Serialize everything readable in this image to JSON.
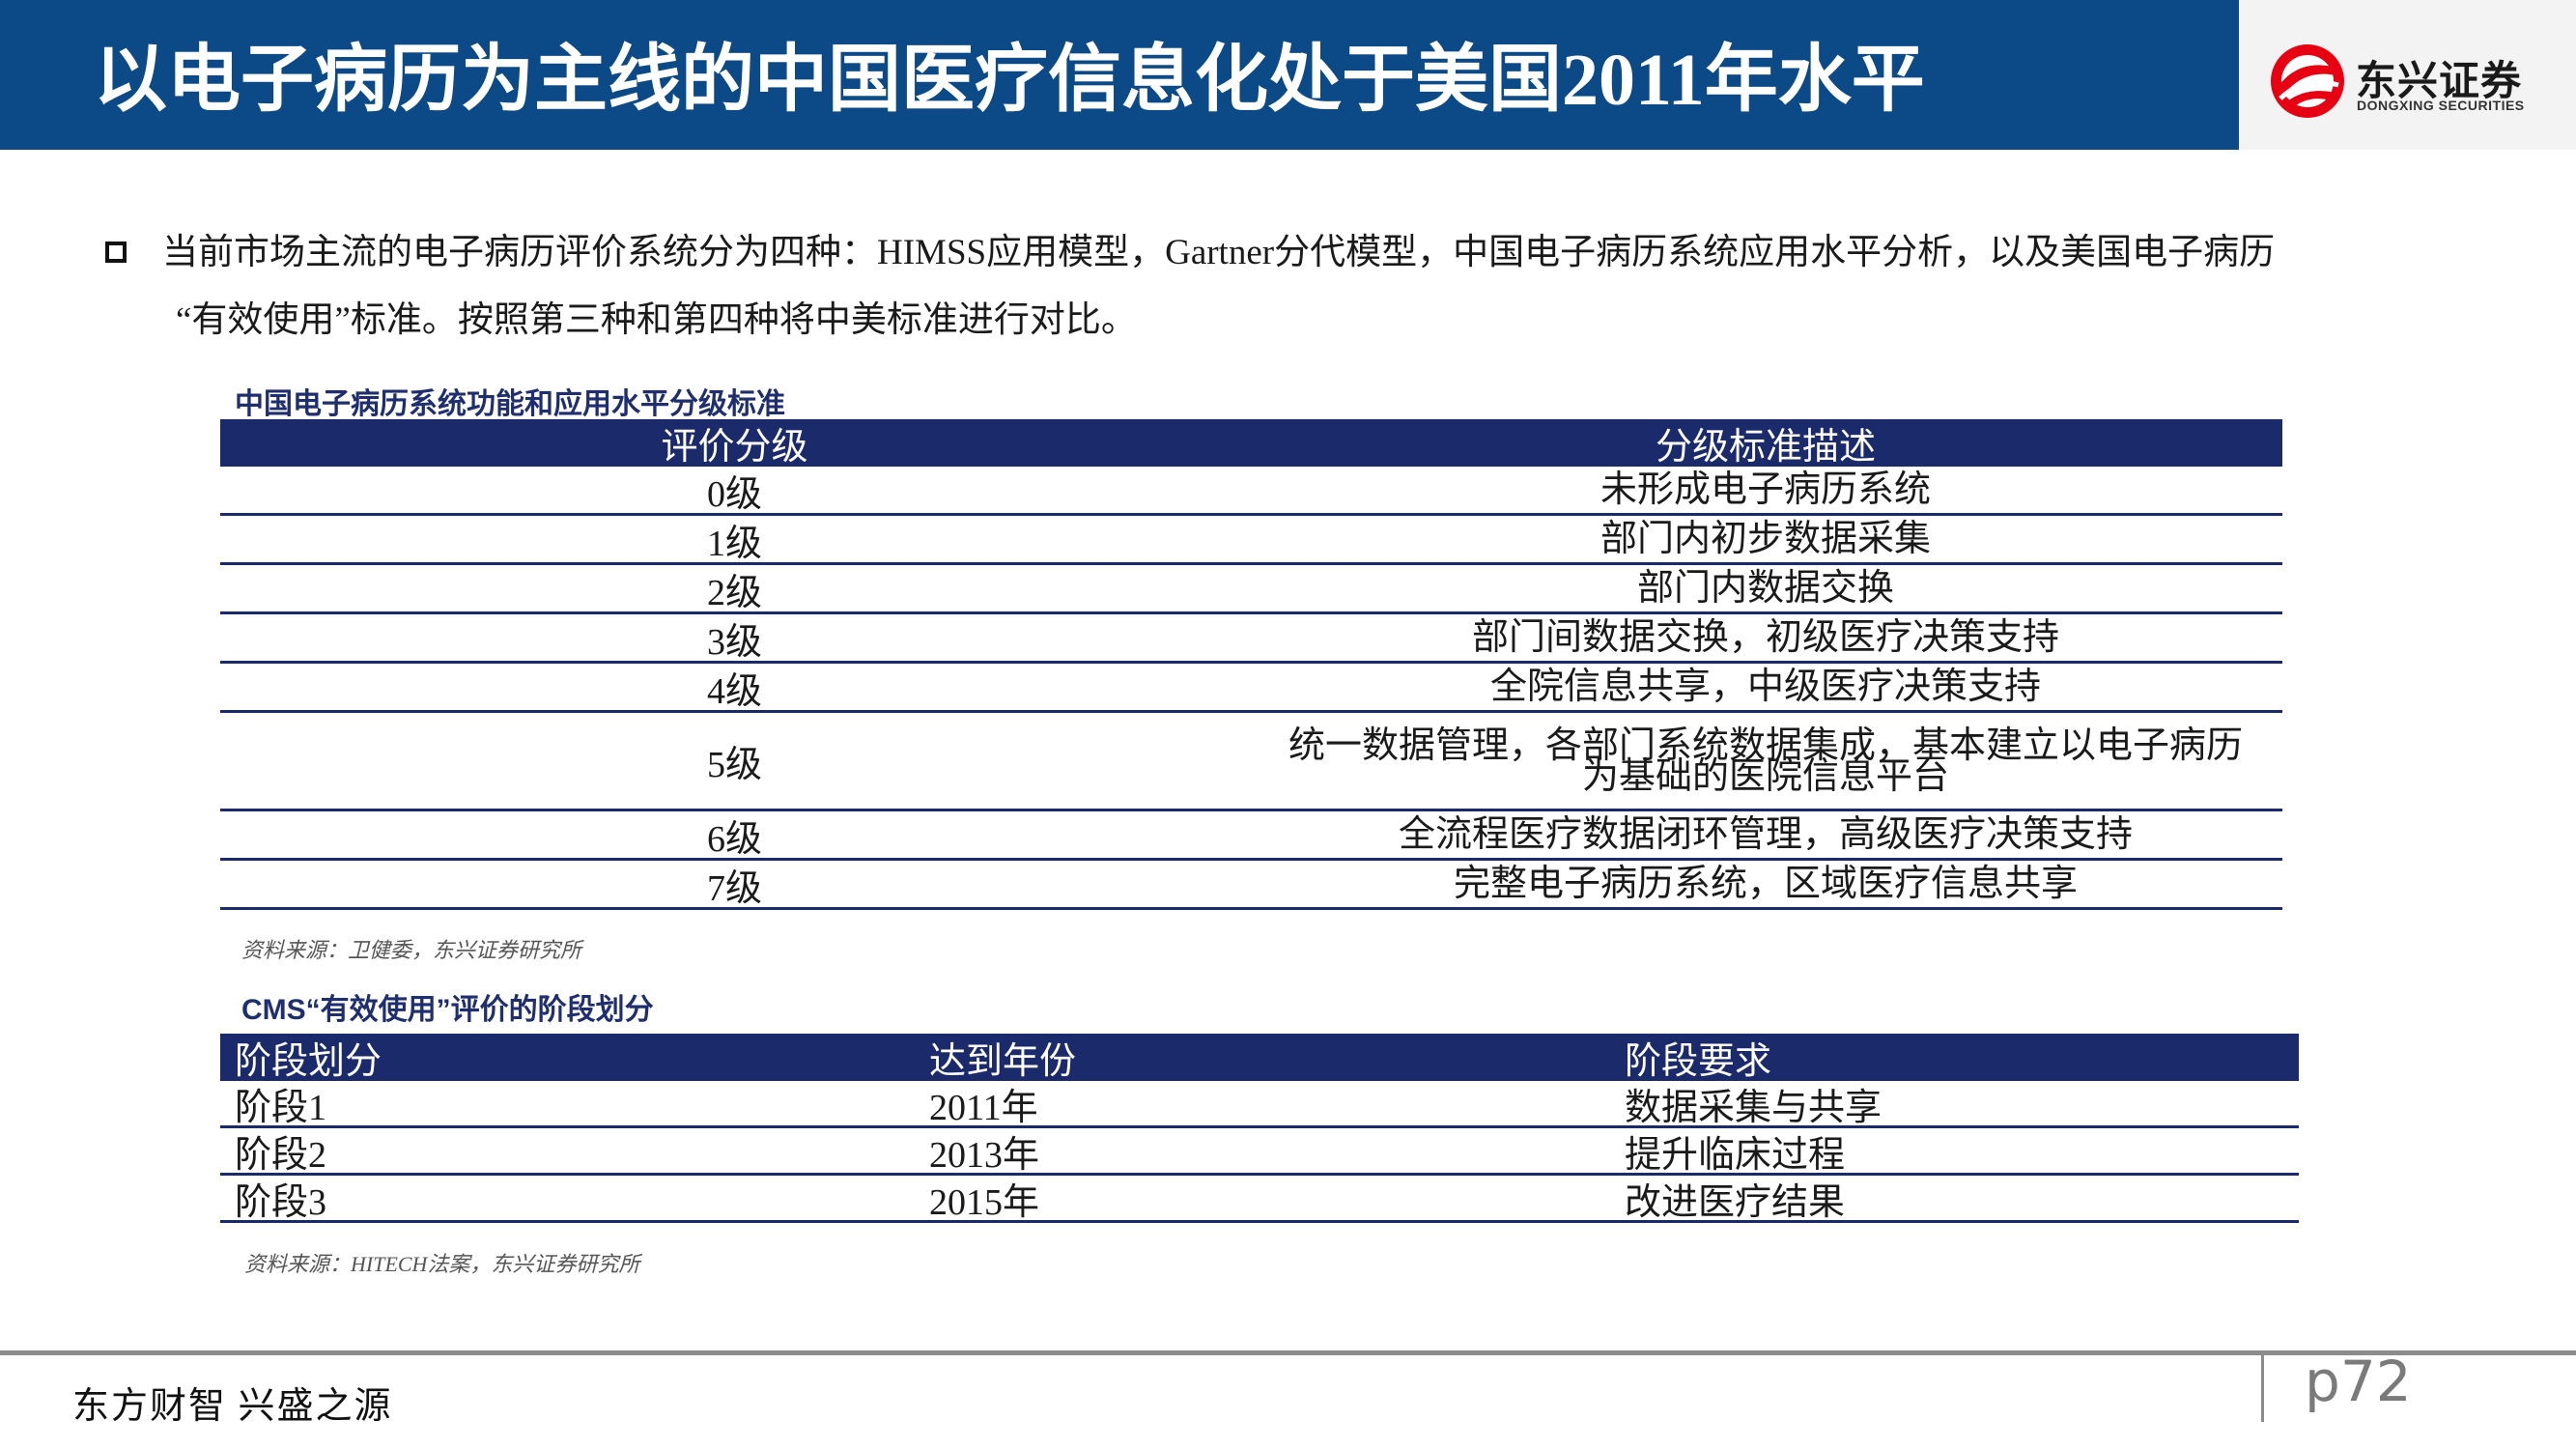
{
  "header": {
    "title": "以电子病历为主线的中国医疗信息化处于美国2011年水平",
    "logo": {
      "icon": "dongxing-logo-icon",
      "name_cn": "东兴证券",
      "name_en": "DONGXING SECURITIES"
    }
  },
  "intro": {
    "bullet_icon": "hollow-square-bullet-icon",
    "line1": "当前市场主流的电子病历评价系统分为四种：HIMSS应用模型，Gartner分代模型，中国电子病历系统应用水平分析，以及美国电子病历",
    "line2": "“有效使用”标准。按照第三种和第四种将中美标准进行对比。"
  },
  "table1": {
    "title": "中国电子病历系统功能和应用水平分级标准",
    "headers": [
      "评价分级",
      "分级标准描述"
    ],
    "rows": [
      {
        "level": "0级",
        "desc_lines": [
          "未形成电子病历系统"
        ]
      },
      {
        "level": "1级",
        "desc_lines": [
          "部门内初步数据采集"
        ]
      },
      {
        "level": "2级",
        "desc_lines": [
          "部门内数据交换"
        ]
      },
      {
        "level": "3级",
        "desc_lines": [
          "部门间数据交换，初级医疗决策支持"
        ]
      },
      {
        "level": "4级",
        "desc_lines": [
          "全院信息共享，中级医疗决策支持"
        ]
      },
      {
        "level": "5级",
        "desc_lines": [
          "统一数据管理，各部门系统数据集成，基本建立以电子病历",
          "为基础的医院信息平台"
        ]
      },
      {
        "level": "6级",
        "desc_lines": [
          "全流程医疗数据闭环管理，高级医疗决策支持"
        ]
      },
      {
        "level": "7级",
        "desc_lines": [
          "完整电子病历系统，区域医疗信息共享"
        ]
      }
    ],
    "source": "资料来源：卫健委，东兴证券研究所"
  },
  "table2": {
    "title": "CMS“有效使用”评价的阶段划分",
    "headers": [
      "阶段划分",
      "达到年份",
      "阶段要求"
    ],
    "rows": [
      [
        "阶段1",
        "2011年",
        "数据采集与共享"
      ],
      [
        "阶段2",
        "2013年",
        "提升临床过程"
      ],
      [
        "阶段3",
        "2015年",
        "改进医疗结果"
      ]
    ],
    "source": "资料来源：HITECH法案，东兴证券研究所"
  },
  "footer": {
    "slogan": "东方财智 兴盛之源",
    "page": "p72"
  },
  "colors": {
    "header_bg": "#0b4a86",
    "table_header_bg": "#1b2a6b",
    "table_rule": "#1b2a6b",
    "table_title": "#1f2e6e",
    "logo_red": "#e60012",
    "footer_rule": "#8c8c8c"
  }
}
